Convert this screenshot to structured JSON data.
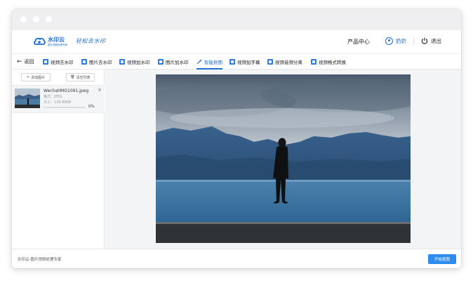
{
  "header": {
    "logo": {
      "name": "水印云",
      "tagline": "图片视频处理专家"
    },
    "slogan": "轻松去水印",
    "nav": {
      "product_center": "产品中心"
    },
    "user": {
      "name": "奶奶"
    },
    "logout": "退出"
  },
  "toolbar": {
    "back": "返回",
    "tools": [
      {
        "label": "视频去水印"
      },
      {
        "label": "图片去水印"
      },
      {
        "label": "视频加水印"
      },
      {
        "label": "图片加水印"
      },
      {
        "label": "智能抠图",
        "active": true
      },
      {
        "label": "视频加字幕"
      },
      {
        "label": "视频音频分离"
      },
      {
        "label": "视频格式转换"
      }
    ]
  },
  "sidebar": {
    "add_image": "添加图片",
    "clear_list": "清空列表",
    "file": {
      "name": "WechatIMG1091.jpeg",
      "format": "格式：JPEG",
      "size": "大小：139.89KB",
      "progress": "0%",
      "progress_value": 0
    }
  },
  "footer": {
    "text": "水印云-图片视频处理专家",
    "start_button": "开始抠图"
  },
  "colors": {
    "accent": "#1f6ed4",
    "button": "#2f8cef",
    "tool_icon": "#2f7de1"
  }
}
